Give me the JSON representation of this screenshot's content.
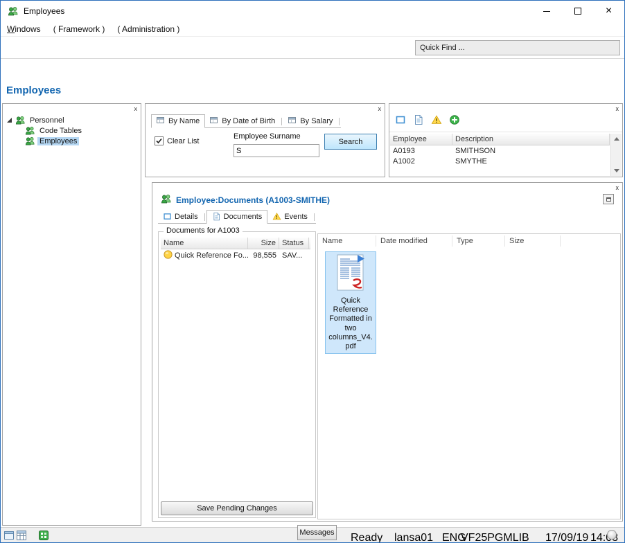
{
  "titlebar": {
    "title": "Employees"
  },
  "menubar": {
    "items": [
      "Windows",
      "( Framework )",
      "( Administration )"
    ]
  },
  "toolbar": {
    "quick_find": "Quick Find ..."
  },
  "page": {
    "heading": "Employees"
  },
  "tree_panel": {
    "close": "x",
    "root": "Personnel",
    "children": [
      {
        "label": "Code Tables"
      },
      {
        "label": "Employees"
      }
    ]
  },
  "search_panel": {
    "close": "x",
    "tabs": [
      {
        "label": "By Name"
      },
      {
        "label": "By Date of Birth"
      },
      {
        "label": "By Salary"
      }
    ],
    "clear_list": "Clear List",
    "surname_label": "Employee Surname",
    "surname_value": "S",
    "search_button": "Search"
  },
  "results_panel": {
    "close": "x",
    "columns": {
      "employee": "Employee",
      "description": "Description"
    },
    "rows": [
      {
        "employee": "A0193",
        "description": "SMITHSON"
      },
      {
        "employee": "A1002",
        "description": "SMYTHE"
      }
    ]
  },
  "documents_panel": {
    "close": "x",
    "title": "Employee:Documents (A1003-SMITHE)",
    "tabs": [
      {
        "label": "Details"
      },
      {
        "label": "Documents"
      },
      {
        "label": "Events"
      }
    ],
    "group_label": "Documents for A1003",
    "grid": {
      "columns": {
        "name": "Name",
        "size": "Size",
        "status": "Status"
      },
      "rows": [
        {
          "name": "Quick Reference Fo...",
          "size": "98,555",
          "status": "SAV..."
        }
      ]
    },
    "save_button": "Save Pending Changes",
    "files": {
      "columns": {
        "name": "Name",
        "date_modified": "Date modified",
        "type": "Type",
        "size": "Size"
      },
      "items": [
        {
          "name": "Quick Reference Formatted in two columns_V4. pdf"
        }
      ]
    }
  },
  "statusbar": {
    "messages": "Messages",
    "status": "Ready",
    "user": "lansa01",
    "language": "ENG",
    "library": "VF25PGMLIB",
    "date": "17/09/19",
    "time": "14:03"
  }
}
